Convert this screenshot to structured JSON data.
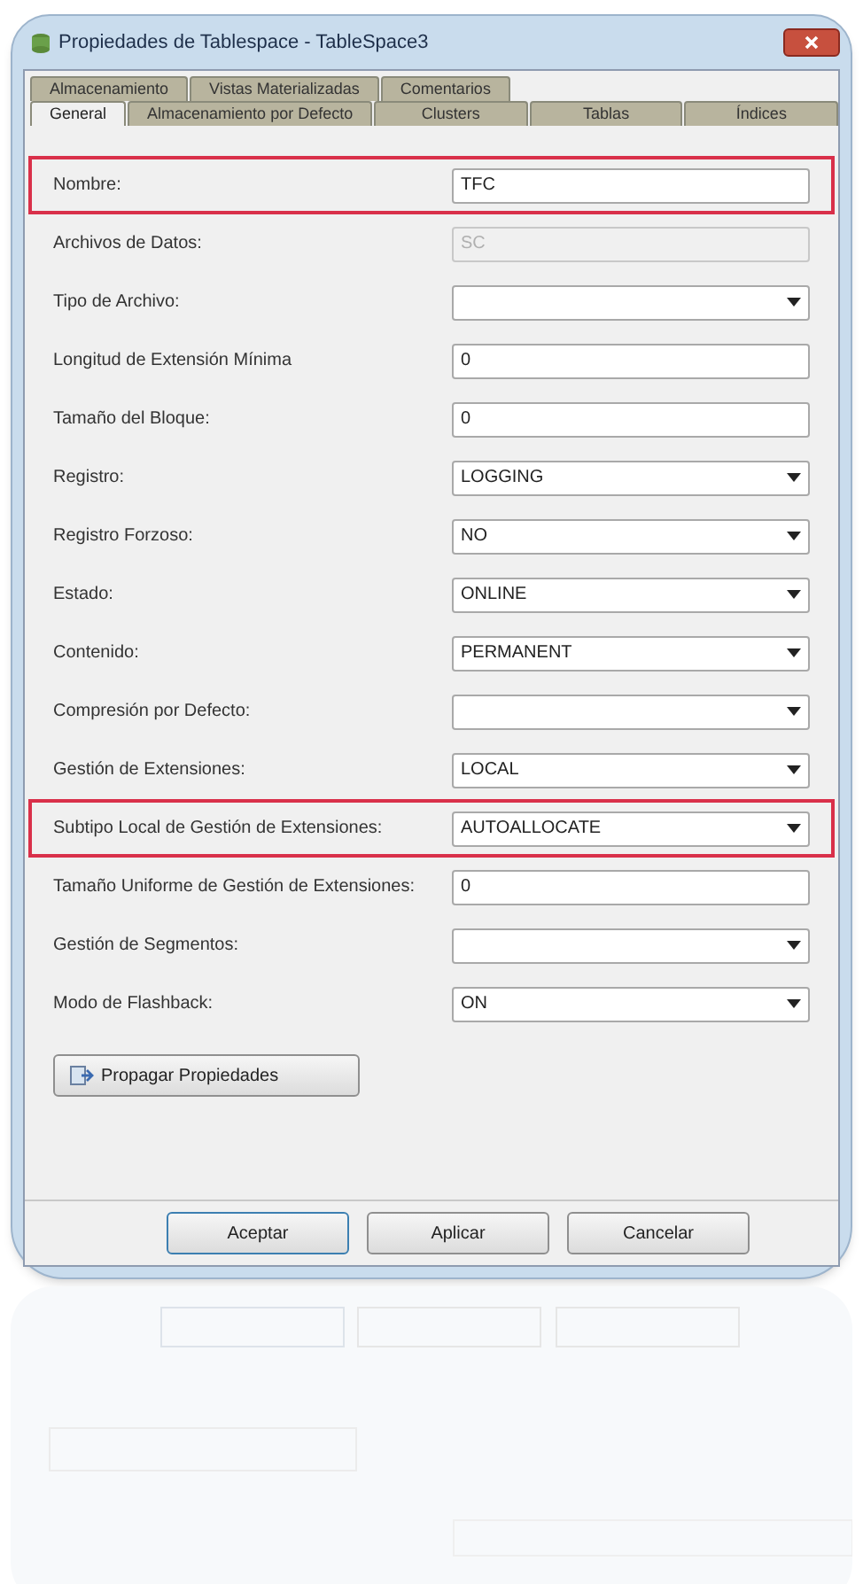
{
  "window": {
    "title": "Propiedades de Tablespace - TableSpace3"
  },
  "tab_rows": [
    [
      {
        "label": "Almacenamiento",
        "selected": false
      },
      {
        "label": "Vistas Materializadas",
        "selected": false
      },
      {
        "label": "Comentarios",
        "selected": false
      }
    ],
    [
      {
        "label": "General",
        "selected": true
      },
      {
        "label": "Almacenamiento por Defecto",
        "selected": false
      },
      {
        "label": "Clusters",
        "selected": false
      },
      {
        "label": "Tablas",
        "selected": false
      },
      {
        "label": "Índices",
        "selected": false
      }
    ]
  ],
  "fields": [
    {
      "label": "Nombre:",
      "kind": "text",
      "value": "TFC",
      "highlighted": true,
      "disabled": false
    },
    {
      "label": "Archivos de Datos:",
      "kind": "text",
      "value": "SC",
      "highlighted": false,
      "disabled": true
    },
    {
      "label": "Tipo de Archivo:",
      "kind": "select",
      "highlighted": false,
      "disabled": false
    },
    {
      "label": "Longitud de Extensión Mínima",
      "kind": "text",
      "value": "0",
      "highlighted": false,
      "disabled": false
    },
    {
      "label": "Tamaño del Bloque:",
      "kind": "text",
      "value": "0",
      "highlighted": false,
      "disabled": false
    },
    {
      "label": "Registro:",
      "kind": "select",
      "value": "LOGGING",
      "highlighted": false,
      "disabled": false
    },
    {
      "label": "Registro Forzoso:",
      "kind": "select",
      "value": "NO",
      "highlighted": false,
      "disabled": false
    },
    {
      "label": "Estado:",
      "kind": "select",
      "value": "ONLINE",
      "highlighted": false,
      "disabled": false
    },
    {
      "label": "Contenido:",
      "kind": "select",
      "value": "PERMANENT",
      "highlighted": false,
      "disabled": false
    },
    {
      "label": "Compresión por Defecto:",
      "kind": "select",
      "highlighted": false,
      "disabled": false
    },
    {
      "label": "Gestión de Extensiones:",
      "kind": "select",
      "value": "LOCAL",
      "highlighted": false,
      "disabled": false
    },
    {
      "label": "Subtipo Local de Gestión de Extensiones:",
      "kind": "select",
      "value": "AUTOALLOCATE",
      "highlighted": true,
      "disabled": false
    },
    {
      "label": "Tamaño Uniforme de Gestión de Extensiones:",
      "kind": "text",
      "value": "0",
      "highlighted": false,
      "disabled": false
    },
    {
      "label": "Gestión de Segmentos:",
      "kind": "select",
      "highlighted": false,
      "disabled": false
    },
    {
      "label": "Modo de Flashback:",
      "kind": "select",
      "value": "ON",
      "highlighted": false,
      "disabled": false
    }
  ],
  "propagate_button": "Propagar Propiedades",
  "buttons": [
    "Aceptar",
    "Aplicar",
    "Cancelar"
  ]
}
